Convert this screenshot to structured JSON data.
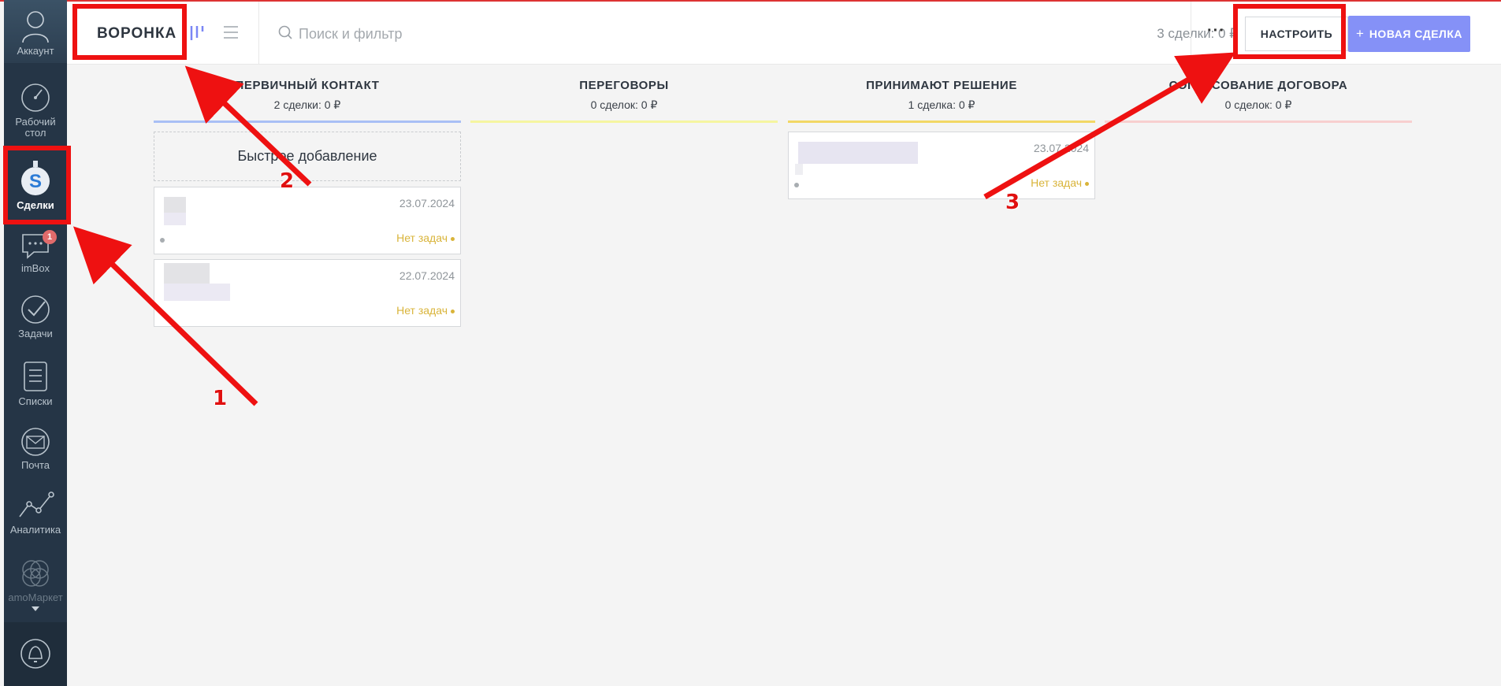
{
  "sidebar": {
    "items": [
      {
        "label": "Аккаунт",
        "icon": "account-icon"
      },
      {
        "label": "Рабочий стол",
        "icon": "dashboard-icon"
      },
      {
        "label": "Сделки",
        "icon": "deals-icon",
        "active": true
      },
      {
        "label": "imBox",
        "icon": "chat-icon",
        "badge": "1"
      },
      {
        "label": "Задачи",
        "icon": "tasks-icon"
      },
      {
        "label": "Списки",
        "icon": "lists-icon"
      },
      {
        "label": "Почта",
        "icon": "mail-icon"
      },
      {
        "label": "Аналитика",
        "icon": "analytics-icon"
      },
      {
        "label": "amoМаркет",
        "icon": "market-icon"
      },
      {
        "label": "",
        "icon": "bell-icon"
      }
    ]
  },
  "header": {
    "title": "ВОРОНКА",
    "search_placeholder": "Поиск и фильтр",
    "summary": "3 сделки: 0 ₽",
    "more": "···",
    "setup_button": "НАСТРОИТЬ",
    "new_deal_button_plus": "+",
    "new_deal_button": "НОВАЯ СДЕЛКА"
  },
  "pipeline": {
    "stages": [
      {
        "title": "ПЕРВИЧНЫЙ КОНТАКТ",
        "count": "2 сделки: 0 ₽",
        "color": "#a9bff5"
      },
      {
        "title": "ПЕРЕГОВОРЫ",
        "count": "0 сделок: 0 ₽",
        "color": "#f5f5a0"
      },
      {
        "title": "ПРИНИМАЮТ РЕШЕНИЕ",
        "count": "1 сделка: 0 ₽",
        "color": "#f2d765"
      },
      {
        "title": "СОГЛАСОВАНИЕ ДОГОВОРА",
        "count": "0 сделок: 0 ₽",
        "color": "#f8cfcf"
      }
    ],
    "quick_add": "Быстрое добавление",
    "cards": [
      {
        "stage": 0,
        "date": "23.07.2024",
        "tasks": "Нет задач"
      },
      {
        "stage": 0,
        "date": "22.07.2024",
        "tasks": "Нет задач"
      },
      {
        "stage": 2,
        "date": "23.07.2024",
        "tasks": "Нет задач"
      }
    ]
  },
  "annotations": {
    "labels": [
      "1",
      "2",
      "3"
    ],
    "color": "#ee1111"
  }
}
